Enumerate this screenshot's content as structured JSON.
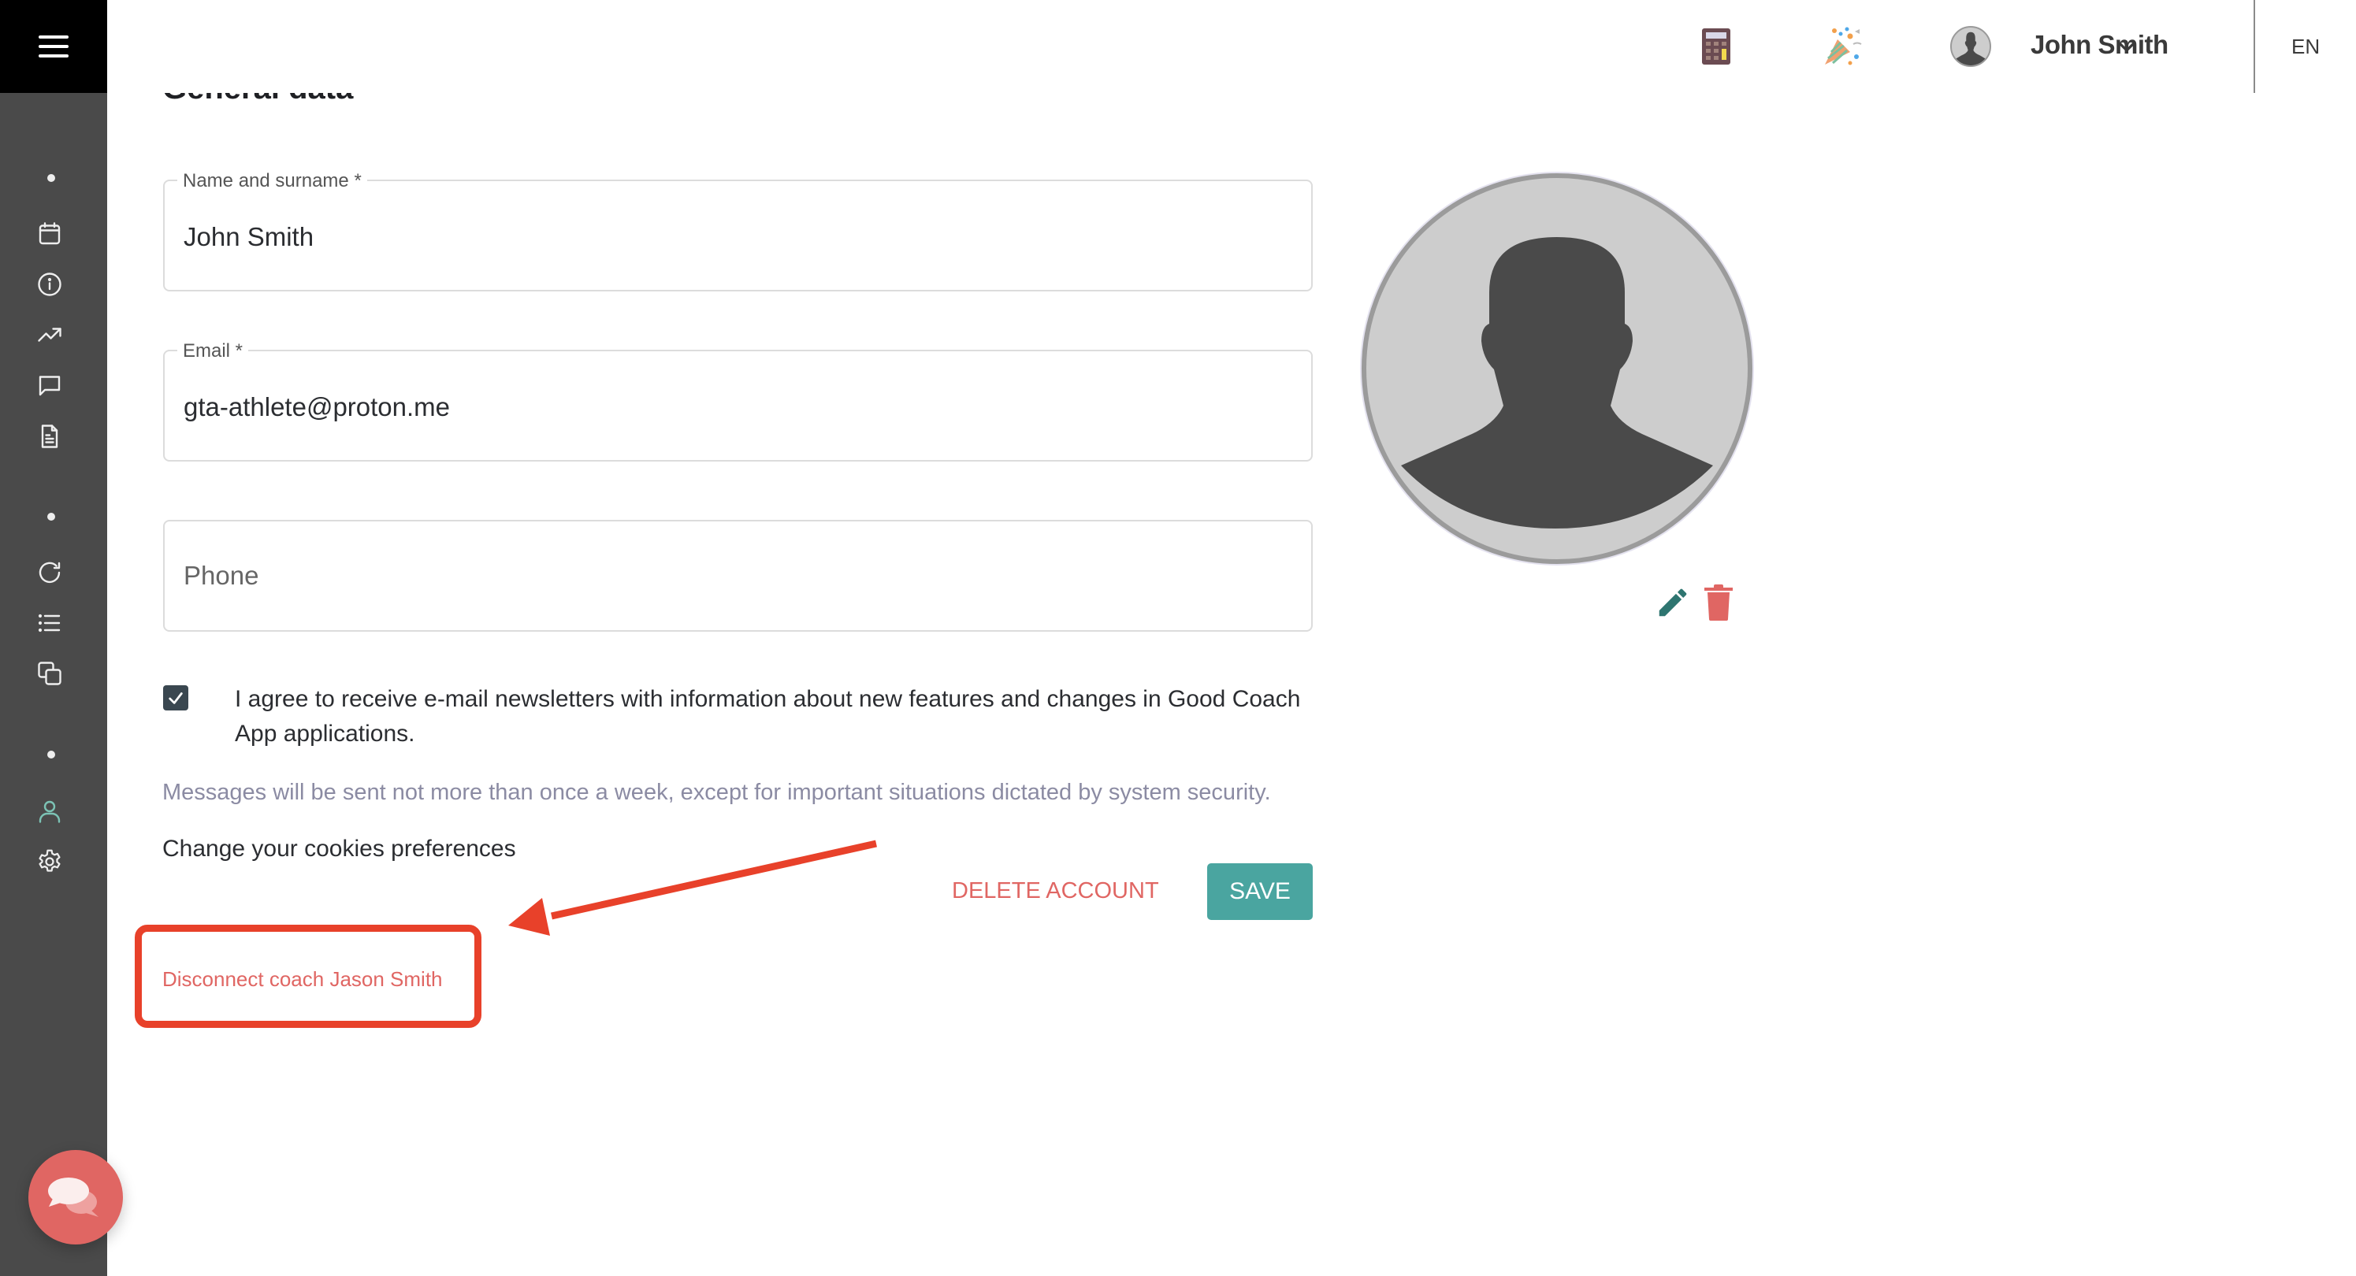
{
  "sidebar": {
    "menu_icon": "hamburger-menu-icon",
    "groups": [
      {
        "items": [
          {
            "icon": "calendar-icon",
            "label": "Calendar"
          },
          {
            "icon": "info-icon",
            "label": "Info"
          },
          {
            "icon": "trending-up-icon",
            "label": "Progress"
          },
          {
            "icon": "chat-bubble-icon",
            "label": "Messages"
          },
          {
            "icon": "document-icon",
            "label": "Documents"
          }
        ]
      },
      {
        "items": [
          {
            "icon": "refresh-icon",
            "label": "Sync"
          },
          {
            "icon": "list-icon",
            "label": "List"
          },
          {
            "icon": "copy-icon",
            "label": "Copy"
          }
        ]
      },
      {
        "items": [
          {
            "icon": "user-icon",
            "label": "Profile",
            "active": true
          },
          {
            "icon": "settings-gear-icon",
            "label": "Settings"
          }
        ]
      }
    ],
    "active_color": "#7cc3b5",
    "chat_fab_icon": "chat-bubbles-icon"
  },
  "header": {
    "icons": [
      "calculator-icon",
      "party-popper-icon"
    ],
    "user_name": "John Smith",
    "language": "EN"
  },
  "section": {
    "title": "General data"
  },
  "form": {
    "name": {
      "label": "Name and surname *",
      "value": "John Smith"
    },
    "email": {
      "label": "Email *",
      "value": "gta-athlete@proton.me"
    },
    "phone": {
      "placeholder": "Phone",
      "value": ""
    },
    "newsletter": {
      "checked": true,
      "label": "I agree to receive e-mail newsletters with information about new features and changes in Good Coach App applications."
    },
    "info_text": "Messages will be sent not more than once a week, except for important situations dictated by system security.",
    "cookies_link": "Change your cookies preferences",
    "delete_account_label": "DELETE ACCOUNT",
    "save_label": "SAVE",
    "disconnect_coach_label": "Disconnect coach Jason Smith"
  },
  "avatar": {
    "edit_icon": "pencil-icon",
    "delete_icon": "trash-icon"
  },
  "colors": {
    "accent_teal": "#4aa5a0",
    "danger_red": "#e06663",
    "annotation_red": "#e8412a",
    "sidebar_bg": "#4a4a4a"
  }
}
